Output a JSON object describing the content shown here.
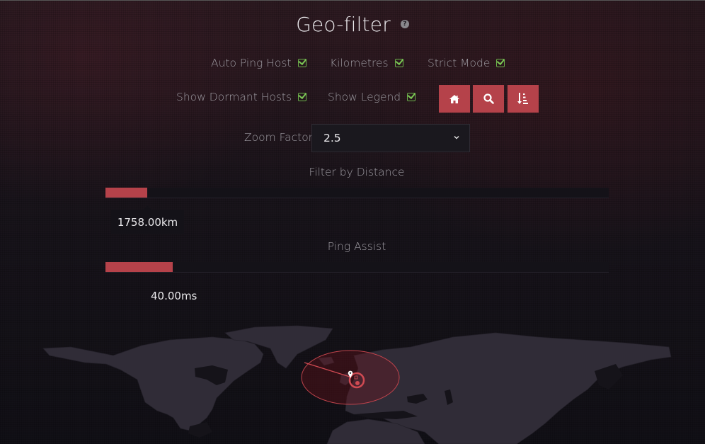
{
  "page": {
    "title": "Geo-filter",
    "help_icon": "question-circle-icon"
  },
  "options": [
    {
      "label": "Auto Ping Host",
      "checked": true
    },
    {
      "label": "Kilometres",
      "checked": true
    },
    {
      "label": "Strict Mode",
      "checked": true
    },
    {
      "label": "Show Dormant Hosts",
      "checked": true
    },
    {
      "label": "Show Legend",
      "checked": true
    }
  ],
  "toolbar": {
    "buttons": [
      {
        "name": "home",
        "icon": "home-icon"
      },
      {
        "name": "search",
        "icon": "search-icon"
      },
      {
        "name": "sort",
        "icon": "sort-amount-icon"
      }
    ],
    "accent_color": "#b5424a"
  },
  "zoom_factor": {
    "label": "Zoom Factor",
    "selected": "2.5"
  },
  "distance_filter": {
    "label": "Filter by Distance",
    "value_text": "1758.00km",
    "fill_fraction": 0.083
  },
  "ping_assist": {
    "label": "Ping Assist",
    "value_text": "40.00ms",
    "fill_fraction": 0.134
  },
  "map": {
    "marker": "map-pin-icon",
    "range_color": "#c0444c"
  }
}
